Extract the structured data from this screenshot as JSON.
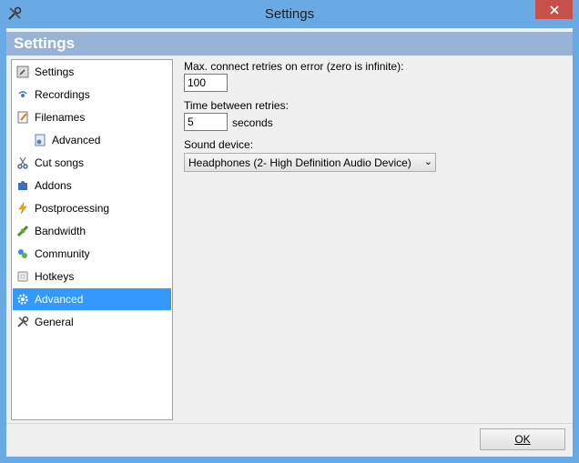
{
  "window": {
    "title": "Settings"
  },
  "banner": {
    "title": "Settings"
  },
  "sidebar": {
    "items": [
      {
        "label": "Settings",
        "icon": "settings-icon",
        "selected": false,
        "indent": 0
      },
      {
        "label": "Recordings",
        "icon": "recordings-icon",
        "selected": false,
        "indent": 0
      },
      {
        "label": "Filenames",
        "icon": "filenames-icon",
        "selected": false,
        "indent": 0
      },
      {
        "label": "Advanced",
        "icon": "advanced-file-icon",
        "selected": false,
        "indent": 1
      },
      {
        "label": "Cut songs",
        "icon": "scissors-icon",
        "selected": false,
        "indent": 0
      },
      {
        "label": "Addons",
        "icon": "puzzle-icon",
        "selected": false,
        "indent": 0
      },
      {
        "label": "Postprocessing",
        "icon": "lightning-icon",
        "selected": false,
        "indent": 0
      },
      {
        "label": "Bandwidth",
        "icon": "plug-icon",
        "selected": false,
        "indent": 0
      },
      {
        "label": "Community",
        "icon": "community-icon",
        "selected": false,
        "indent": 0
      },
      {
        "label": "Hotkeys",
        "icon": "key-icon",
        "selected": false,
        "indent": 0
      },
      {
        "label": "Advanced",
        "icon": "gear-icon",
        "selected": true,
        "indent": 0
      },
      {
        "label": "General",
        "icon": "tools-icon",
        "selected": false,
        "indent": 0
      }
    ]
  },
  "main": {
    "retries_label": "Max. connect retries on error (zero is infinite):",
    "retries_value": "100",
    "time_label": "Time between retries:",
    "time_value": "5",
    "time_unit": "seconds",
    "sound_label": "Sound device:",
    "sound_value": "Headphones (2- High Definition Audio Device)"
  },
  "footer": {
    "ok_label": "OK"
  },
  "colors": {
    "titlebar": "#6aaae4",
    "banner": "#97b3d5",
    "selection": "#3399ff",
    "close": "#c7504b"
  }
}
